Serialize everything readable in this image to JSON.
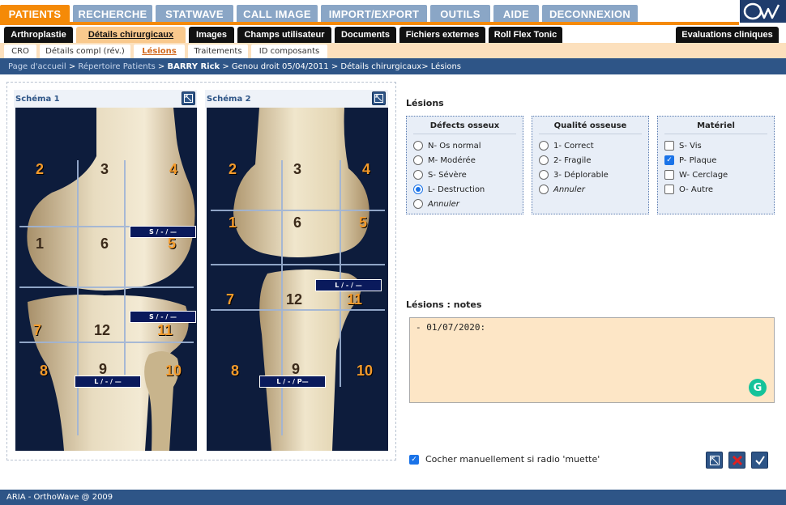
{
  "top_tabs": [
    {
      "label": "PATIENTS",
      "active": true
    },
    {
      "label": "RECHERCHE",
      "active": false
    },
    {
      "label": "STATWAVE",
      "active": false
    },
    {
      "label": "CALL IMAGE",
      "active": false
    },
    {
      "label": "IMPORT/EXPORT",
      "active": false
    },
    {
      "label": "OUTILS",
      "active": false
    },
    {
      "label": "AIDE",
      "active": false
    },
    {
      "label": "DECONNEXION",
      "active": false
    }
  ],
  "logo": {
    "name": "orthowave-logo-icon"
  },
  "sub_tabs": [
    {
      "label": "Arthroplastie",
      "active": false
    },
    {
      "label": "Détails chirurgicaux",
      "active": true
    },
    {
      "label": "Images",
      "active": false
    },
    {
      "label": "Champs utilisateur",
      "active": false
    },
    {
      "label": "Documents",
      "active": false
    },
    {
      "label": "Fichiers externes",
      "active": false
    },
    {
      "label": "Roll Flex Tonic",
      "active": false
    },
    {
      "label": "Evaluations cliniques",
      "active": false
    }
  ],
  "third_tabs": [
    {
      "label": "CRO",
      "active": false
    },
    {
      "label": "Détails compl (rév.)",
      "active": false
    },
    {
      "label": "Lésions",
      "active": true
    },
    {
      "label": "Traitements",
      "active": false
    },
    {
      "label": "ID composants",
      "active": false
    }
  ],
  "breadcrumb": {
    "home": "Page d'accueil",
    "sep1": " > ",
    "patients": "Répertoire Patients",
    "sep2": " > ",
    "patient": "BARRY Rick",
    "rest": " > Genou droit 05/04/2011 > Détails chirurgicaux> Lésions"
  },
  "schema1": {
    "title": "Schéma 1",
    "zones": [
      "2",
      "3",
      "4",
      "1",
      "6",
      "5",
      "7",
      "12",
      "11",
      "8",
      "9",
      "10"
    ],
    "labels": [
      "S / - / —",
      "S / - / —",
      "L / - / —"
    ]
  },
  "schema2": {
    "title": "Schéma 2",
    "zones": [
      "2",
      "3",
      "4",
      "1",
      "6",
      "5",
      "7",
      "12",
      "11",
      "8",
      "9",
      "10"
    ],
    "labels": [
      "L / - / —",
      "L / - / P—"
    ]
  },
  "lesions": {
    "title": "Lésions",
    "defects": {
      "title": "Défects osseux",
      "options": [
        {
          "label": "N- Os normal",
          "checked": false,
          "italic": false
        },
        {
          "label": "M- Modérée",
          "checked": false,
          "italic": false
        },
        {
          "label": "S- Sévère",
          "checked": false,
          "italic": false
        },
        {
          "label": "L- Destruction",
          "checked": true,
          "italic": false
        },
        {
          "label": "Annuler",
          "checked": false,
          "italic": true
        }
      ]
    },
    "quality": {
      "title": "Qualité osseuse",
      "options": [
        {
          "label": "1- Correct",
          "checked": false,
          "italic": false
        },
        {
          "label": "2- Fragile",
          "checked": false,
          "italic": false
        },
        {
          "label": "3- Déplorable",
          "checked": false,
          "italic": false
        },
        {
          "label": "Annuler",
          "checked": false,
          "italic": true
        }
      ]
    },
    "material": {
      "title": "Matériel",
      "options": [
        {
          "label": "S- Vis",
          "checked": false
        },
        {
          "label": "P- Plaque",
          "checked": true
        },
        {
          "label": "W- Cerclage",
          "checked": false
        },
        {
          "label": "O- Autre",
          "checked": false
        }
      ]
    }
  },
  "notes": {
    "title": "Lésions : notes",
    "value": "- 01/07/2020:"
  },
  "manual_check": {
    "label": "Cocher manuellement si radio 'muette'",
    "checked": true
  },
  "actions": [
    {
      "name": "expand-button",
      "icon": "expand-icon"
    },
    {
      "name": "delete-button",
      "icon": "x-icon"
    },
    {
      "name": "validate-button",
      "icon": "check-icon"
    }
  ],
  "footer": {
    "text": "ARIA - OrthoWave @ 2009"
  },
  "colors": {
    "accent": "#f58a07",
    "nav_blue": "#8aa6c6",
    "dark_blue": "#2e5587",
    "notes_bg": "#fde6c6"
  }
}
